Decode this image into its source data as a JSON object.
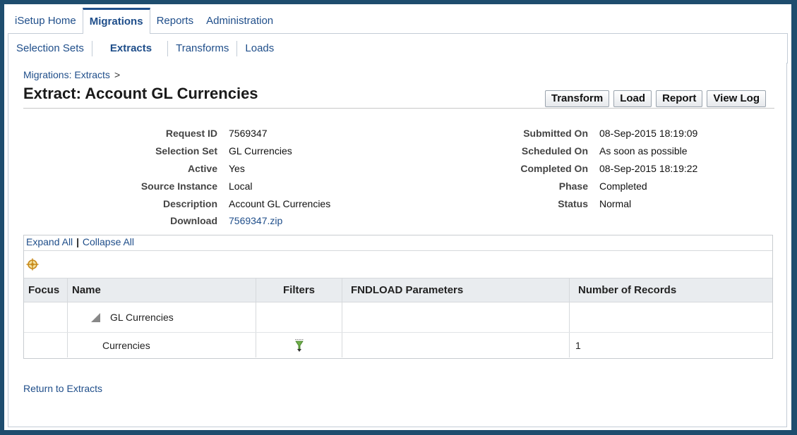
{
  "tabs": [
    "iSetup Home",
    "Migrations",
    "Reports",
    "Administration"
  ],
  "active_tab": "Migrations",
  "subtabs": [
    "Selection Sets",
    "Extracts",
    "Transforms",
    "Loads"
  ],
  "active_subtab": "Extracts",
  "breadcrumb": {
    "link": "Migrations: Extracts",
    "arrow": ">"
  },
  "page_title": "Extract: Account GL Currencies",
  "buttons": {
    "transform": "Transform",
    "load": "Load",
    "report": "Report",
    "view_log": "View Log"
  },
  "details_left": [
    {
      "label": "Request ID",
      "value": "7569347"
    },
    {
      "label": "Selection Set",
      "value": "GL Currencies"
    },
    {
      "label": "Active",
      "value": "Yes"
    },
    {
      "label": "Source Instance",
      "value": "Local"
    },
    {
      "label": "Description",
      "value": "Account GL Currencies"
    },
    {
      "label": "Download",
      "value": "7569347.zip"
    }
  ],
  "details_right": [
    {
      "label": "Submitted On",
      "value": "08-Sep-2015 18:19:09"
    },
    {
      "label": "Scheduled On",
      "value": "As soon as possible"
    },
    {
      "label": "Completed On",
      "value": "08-Sep-2015 18:19:22"
    },
    {
      "label": "Phase",
      "value": "Completed"
    },
    {
      "label": "Status",
      "value": "Normal"
    }
  ],
  "tree_controls": {
    "expand_all": "Expand All",
    "separator": "|",
    "collapse_all": "Collapse All"
  },
  "table": {
    "headers": {
      "focus": "Focus",
      "name": "Name",
      "filters": "Filters",
      "fndload": "FNDLOAD Parameters",
      "records": "Number of Records"
    },
    "rows": [
      {
        "name": "GL Currencies",
        "records": ""
      },
      {
        "name": "Currencies",
        "records": "1"
      }
    ]
  },
  "return_link": "Return to Extracts",
  "colors": {
    "link": "#1f4e8a",
    "frame": "#1e4d6e",
    "header_bg": "#e9ecef"
  },
  "icons": {
    "focus": "crosshair-target-icon",
    "filter": "filter-funnel-icon",
    "expand": "triangle-expanded-icon"
  }
}
